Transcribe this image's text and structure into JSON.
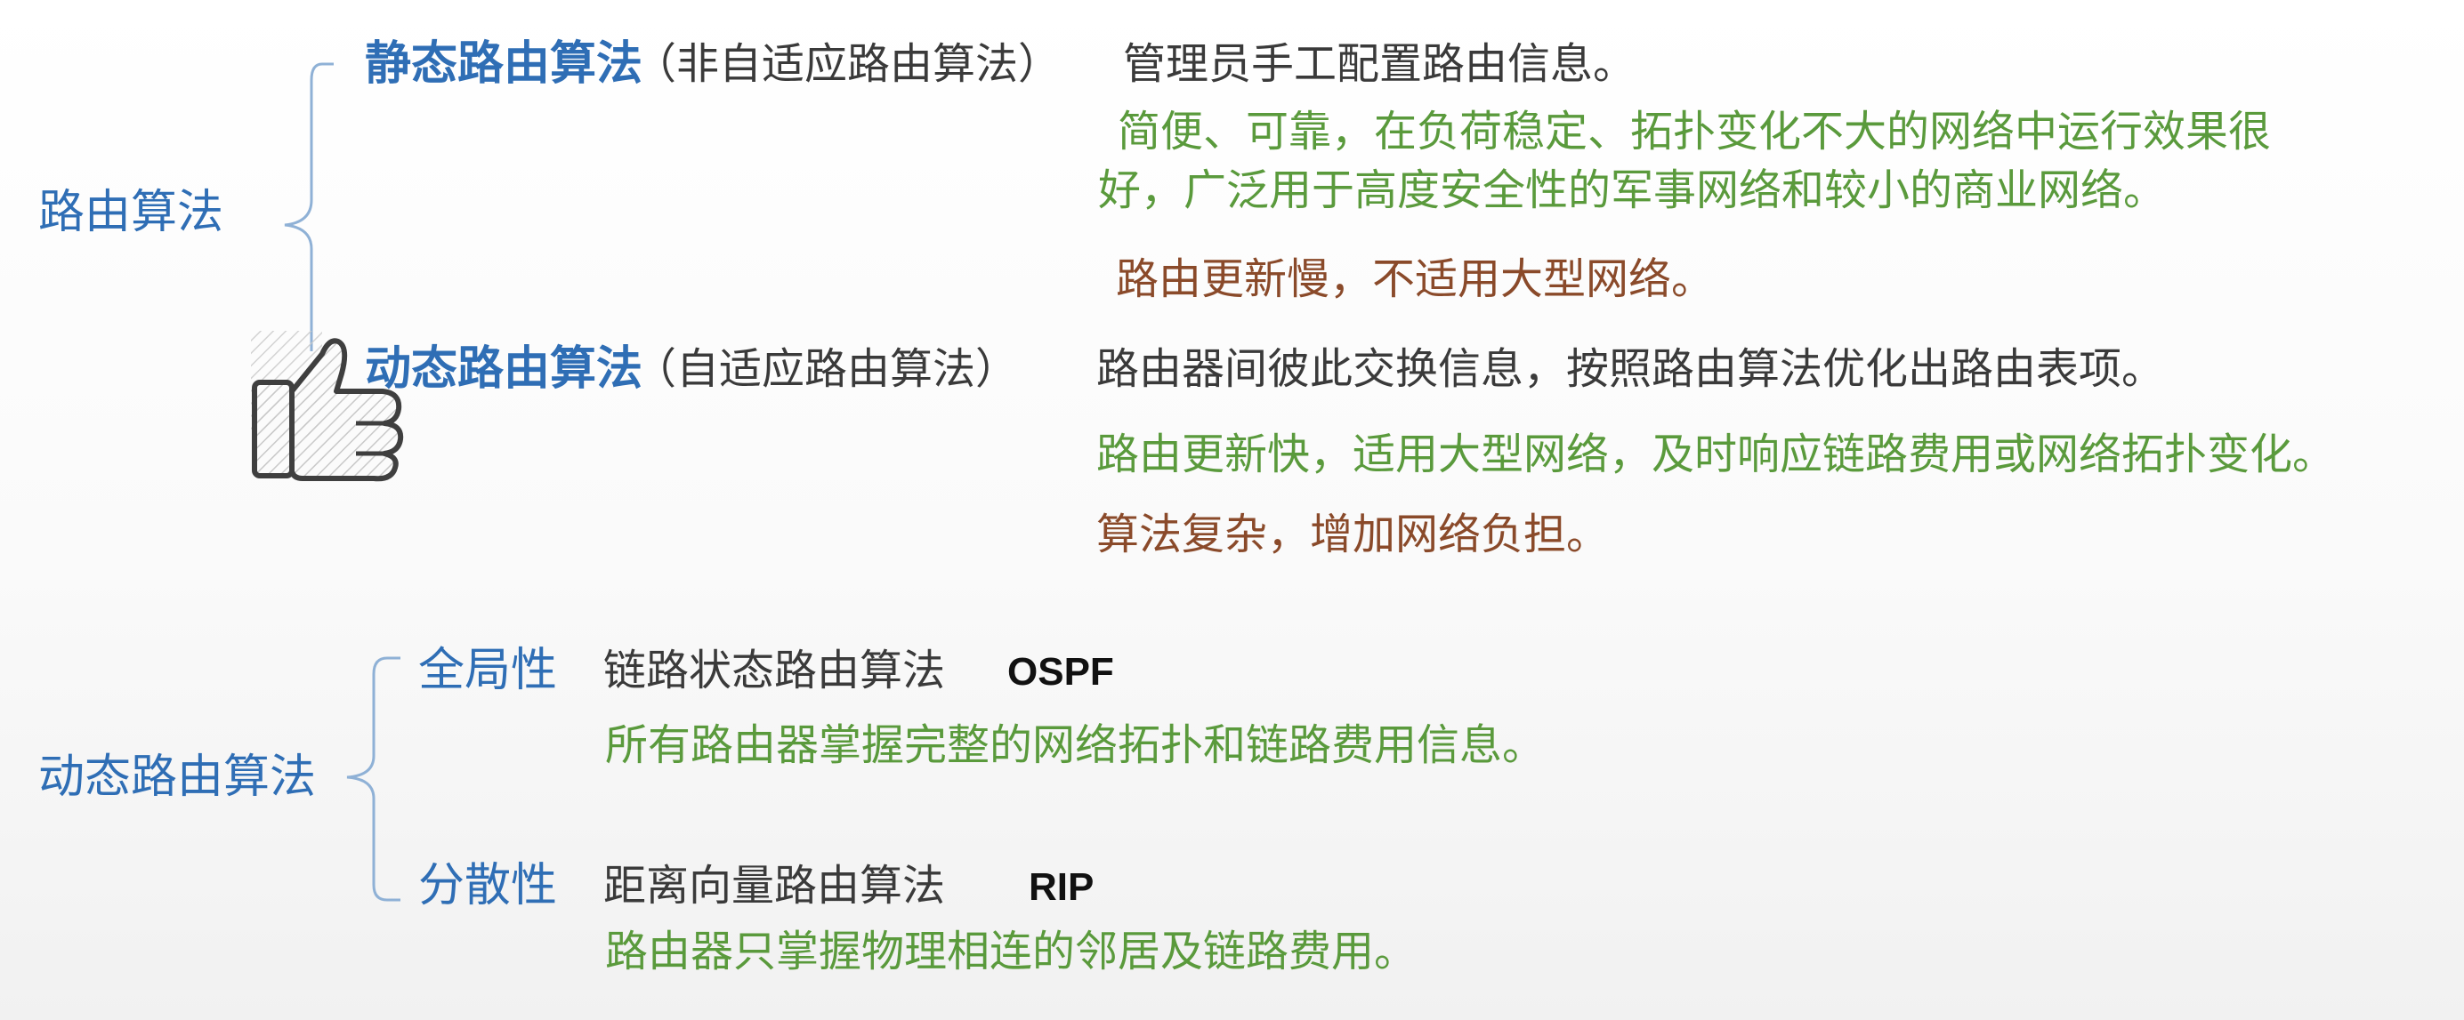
{
  "section1": {
    "root": "路由算法",
    "static": {
      "title": "静态路由算法",
      "alias": "（非自适应路由算法）",
      "desc": "管理员手工配置路由信息。",
      "pros_line1": "简便、可靠，在负荷稳定、拓扑变化不大的网络中运行效果很",
      "pros_line2": "好，广泛用于高度安全性的军事网络和较小的商业网络。",
      "cons": "路由更新慢，不适用大型网络。"
    },
    "dynamic": {
      "title": "动态路由算法",
      "alias": "（自适应路由算法）",
      "desc": "路由器间彼此交换信息，按照路由算法优化出路由表项。",
      "pros": "路由更新快，适用大型网络，及时响应链路费用或网络拓扑变化。",
      "cons": "算法复杂，增加网络负担。"
    },
    "thumbs_icon": "thumbs-up-icon"
  },
  "section2": {
    "root": "动态路由算法",
    "global": {
      "title": "全局性",
      "name": "链路状态路由算法",
      "protocol": "OSPF",
      "desc": "所有路由器掌握完整的网络拓扑和链路费用信息。"
    },
    "distributed": {
      "title": "分散性",
      "name": "距离向量路由算法",
      "protocol": "RIP",
      "desc": "路由器只掌握物理相连的邻居及链路费用。"
    }
  },
  "colors": {
    "heading": "#2f6eb5",
    "body": "#3a3a3a",
    "pros": "#5a9a3c",
    "cons": "#8a4a2a",
    "brace": "#8fb1d6"
  }
}
